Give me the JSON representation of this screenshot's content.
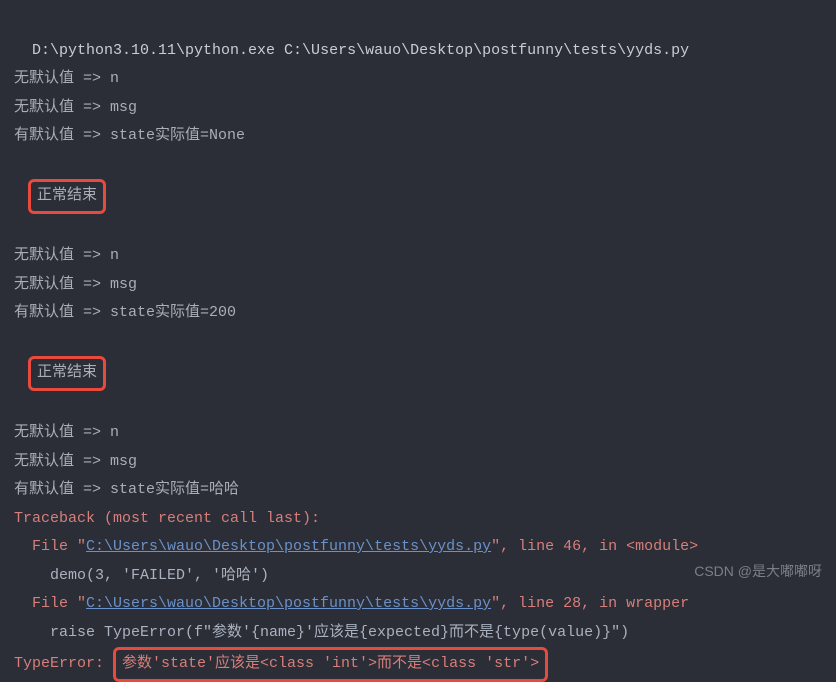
{
  "command": "D:\\python3.10.11\\python.exe C:\\Users\\wauo\\Desktop\\postfunny\\tests\\yyds.py",
  "block1": {
    "l1": "无默认值 => n",
    "l2": "无默认值 => msg",
    "l3": "有默认值 => state实际值=None",
    "result": "正常结束"
  },
  "block2": {
    "l1": "无默认值 => n",
    "l2": "无默认值 => msg",
    "l3": "有默认值 => state实际值=200",
    "result": "正常结束"
  },
  "block3": {
    "l1": "无默认值 => n",
    "l2": "无默认值 => msg",
    "l3": "有默认值 => state实际值=哈哈"
  },
  "traceback": {
    "header": "Traceback (most recent call last):",
    "f1_prefix": "  File \"",
    "f1_path": "C:\\Users\\wauo\\Desktop\\postfunny\\tests\\yyds.py",
    "f1_suffix": "\", line 46, in <module>",
    "f1_code": "    demo(3, 'FAILED', '哈哈')",
    "f2_prefix": "  File \"",
    "f2_path": "C:\\Users\\wauo\\Desktop\\postfunny\\tests\\yyds.py",
    "f2_suffix": "\", line 28, in wrapper",
    "f2_code": "    raise TypeError(f\"参数'{name}'应该是{expected}而不是{type(value)}\")",
    "err_prefix": "TypeError: ",
    "err_msg": "参数'state'应该是<class 'int'>而不是<class 'str'>"
  },
  "watermark": "CSDN @是大嘟嘟呀"
}
